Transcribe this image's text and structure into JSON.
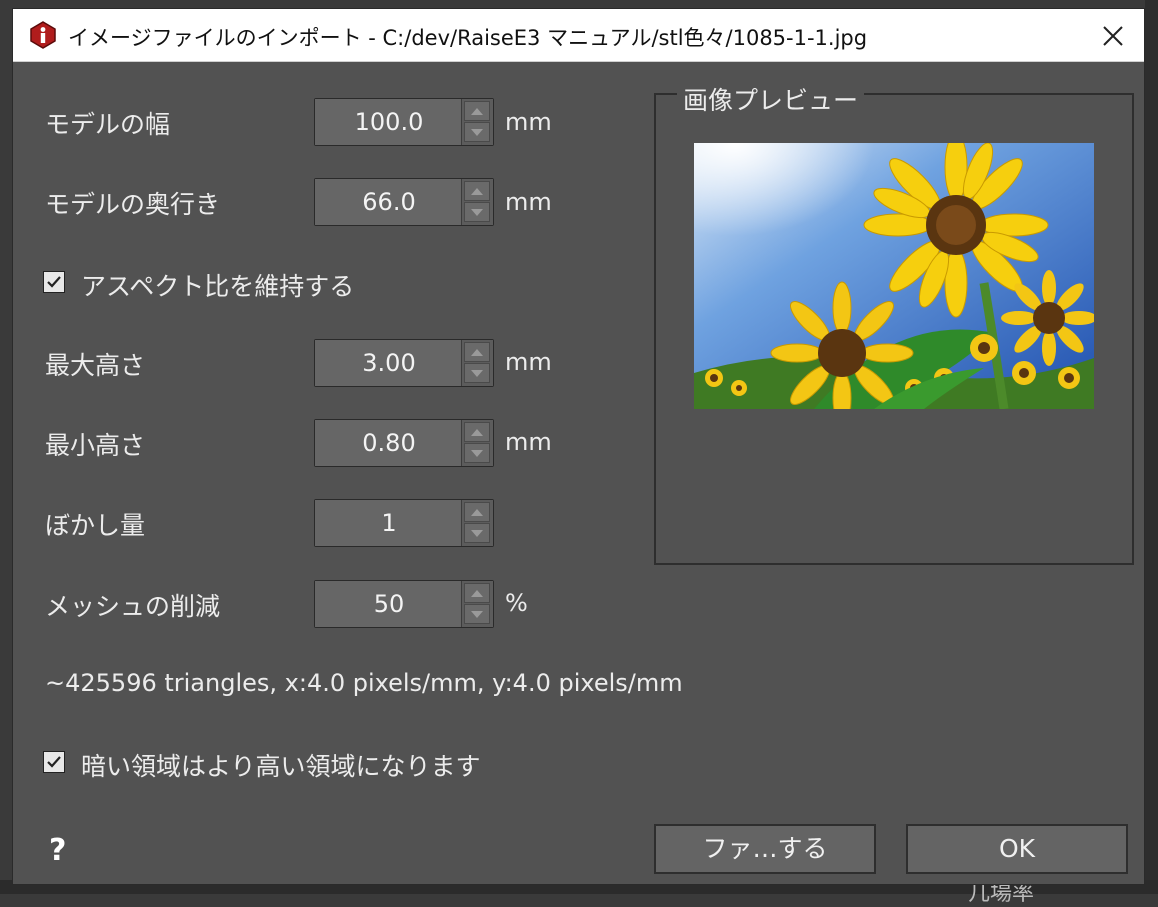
{
  "window": {
    "title": "イメージファイルのインポート - C:/dev/RaiseE3 マニュアル/stl色々/1085-1-1.jpg",
    "app_icon": "info-icon",
    "close_icon": "close-icon"
  },
  "form": {
    "width": {
      "label": "モデルの幅",
      "value": "100.0",
      "unit": "mm"
    },
    "depth": {
      "label": "モデルの奥行き",
      "value": "66.0",
      "unit": "mm"
    },
    "aspect": {
      "label": "アスペクト比を維持する",
      "checked": true
    },
    "max_height": {
      "label": "最大高さ",
      "value": "3.00",
      "unit": "mm"
    },
    "min_height": {
      "label": "最小高さ",
      "value": "0.80",
      "unit": "mm"
    },
    "blur": {
      "label": "ぼかし量",
      "value": "1"
    },
    "mesh": {
      "label": "メッシュの削減",
      "value": "50",
      "unit": "%"
    },
    "stats": "~425596 triangles, x:4.0 pixels/mm, y:4.0 pixels/mm",
    "dark_high": {
      "label": "暗い領域はより高い領域になります",
      "checked": true
    }
  },
  "preview": {
    "title": "画像プレビュー"
  },
  "buttons": {
    "help": "?",
    "save": "ファ…する",
    "ok": "OK"
  },
  "background": {
    "partial_text": "几場率"
  },
  "colors": {
    "dialog_bg": "#525252",
    "field_bg": "#666666",
    "title_bg": "#ffffff",
    "icon_red": "#b01c1c"
  }
}
